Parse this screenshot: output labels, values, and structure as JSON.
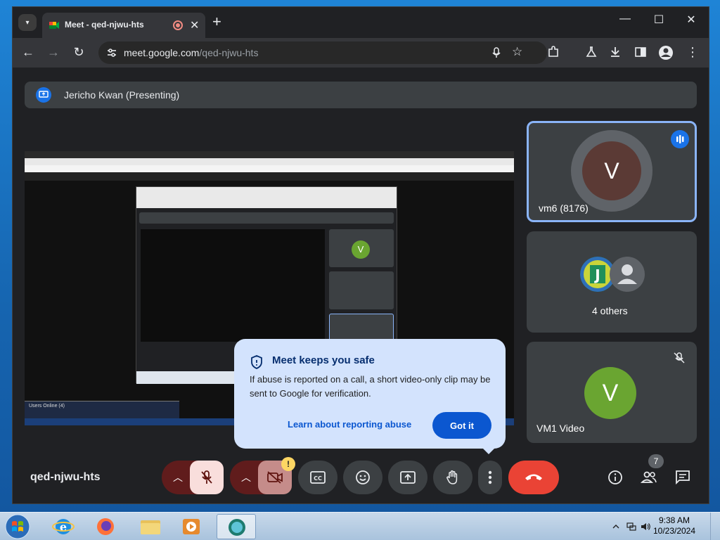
{
  "browser": {
    "tab_title": "Meet - qed-njwu-hts",
    "url_host": "meet.google.com",
    "url_path": "/qed-njwu-hts"
  },
  "meet": {
    "presenting_label": "Jericho Kwan (Presenting)",
    "meeting_code": "qed-njwu-hts",
    "participant_count": "7"
  },
  "tiles": [
    {
      "name": "vm6 (8176)",
      "initial": "V"
    },
    {
      "name": "4 others",
      "initial": "J"
    },
    {
      "name": "VM1 Video",
      "initial": "V"
    }
  ],
  "popup": {
    "title": "Meet keeps you safe",
    "body": "If abuse is reported on a call, a short video-only clip may be sent to Google for verification.",
    "link": "Learn about reporting abuse",
    "button": "Got it"
  },
  "controls": {
    "camera_warning": "!"
  },
  "shared_screen": {
    "users_online": "Users Online (4)"
  },
  "taskbar": {
    "time": "9:38 AM",
    "date": "10/23/2024"
  },
  "colors": {
    "accent_blue": "#0b57d0",
    "end_call_red": "#ea4335",
    "muted_red": "#5c1c1c",
    "meet_bg": "#202124"
  }
}
